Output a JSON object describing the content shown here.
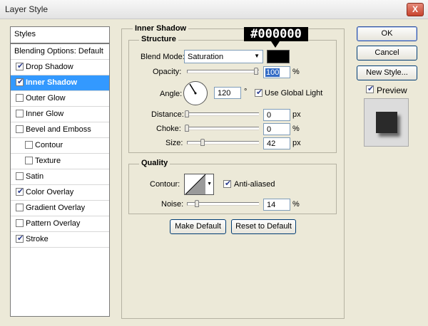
{
  "window": {
    "title": "Layer Style",
    "close_label": "X"
  },
  "styles_panel": {
    "header": "Styles",
    "items": [
      {
        "label": "Blending Options: Default",
        "checkbox": false,
        "checked": false,
        "selected": false,
        "indent": false
      },
      {
        "label": "Drop Shadow",
        "checkbox": true,
        "checked": true,
        "selected": false,
        "indent": false
      },
      {
        "label": "Inner Shadow",
        "checkbox": true,
        "checked": true,
        "selected": true,
        "indent": false
      },
      {
        "label": "Outer Glow",
        "checkbox": true,
        "checked": false,
        "selected": false,
        "indent": false
      },
      {
        "label": "Inner Glow",
        "checkbox": true,
        "checked": false,
        "selected": false,
        "indent": false
      },
      {
        "label": "Bevel and Emboss",
        "checkbox": true,
        "checked": false,
        "selected": false,
        "indent": false
      },
      {
        "label": "Contour",
        "checkbox": true,
        "checked": false,
        "selected": false,
        "indent": true
      },
      {
        "label": "Texture",
        "checkbox": true,
        "checked": false,
        "selected": false,
        "indent": true
      },
      {
        "label": "Satin",
        "checkbox": true,
        "checked": false,
        "selected": false,
        "indent": false
      },
      {
        "label": "Color Overlay",
        "checkbox": true,
        "checked": true,
        "selected": false,
        "indent": false
      },
      {
        "label": "Gradient Overlay",
        "checkbox": true,
        "checked": false,
        "selected": false,
        "indent": false
      },
      {
        "label": "Pattern Overlay",
        "checkbox": true,
        "checked": false,
        "selected": false,
        "indent": false
      },
      {
        "label": "Stroke",
        "checkbox": true,
        "checked": true,
        "selected": false,
        "indent": false
      }
    ]
  },
  "inner_shadow": {
    "group_title": "Inner Shadow",
    "structure": {
      "title": "Structure",
      "blend_mode_label": "Blend Mode:",
      "blend_mode_value": "Saturation",
      "swatch_color": "#000000",
      "color_tooltip": "#000000",
      "opacity_label": "Opacity:",
      "opacity_value": "100",
      "opacity_unit": "%",
      "opacity_level": 1.0,
      "angle_label": "Angle:",
      "angle_value": "120",
      "angle_unit": "°",
      "use_global_light_label": "Use Global Light",
      "use_global_light_checked": true,
      "distance_label": "Distance:",
      "distance_value": "0",
      "distance_unit": "px",
      "choke_label": "Choke:",
      "choke_value": "0",
      "choke_unit": "%",
      "size_label": "Size:",
      "size_value": "42",
      "size_unit": "px"
    },
    "quality": {
      "title": "Quality",
      "contour_label": "Contour:",
      "anti_aliased_label": "Anti-aliased",
      "anti_aliased_checked": true,
      "noise_label": "Noise:",
      "noise_value": "14",
      "noise_unit": "%"
    },
    "make_default_label": "Make Default",
    "reset_default_label": "Reset to Default"
  },
  "actions": {
    "ok_label": "OK",
    "cancel_label": "Cancel",
    "new_style_label": "New Style...",
    "preview_label": "Preview",
    "preview_checked": true
  },
  "colors": {
    "selection": "#3399ff",
    "dialog_bg": "#ece9d8"
  }
}
